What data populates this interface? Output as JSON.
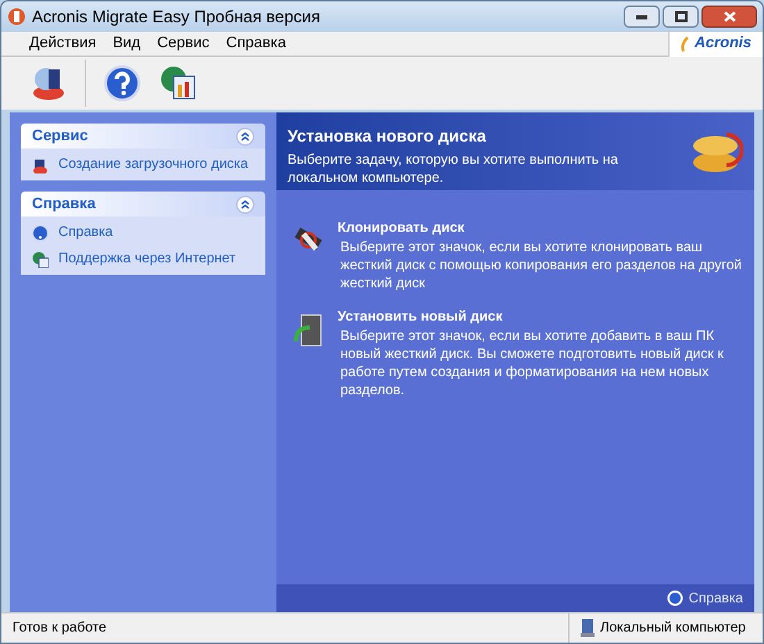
{
  "window": {
    "title": "Acronis Migrate Easy Пробная версия"
  },
  "menu": [
    "Действия",
    "Вид",
    "Сервис",
    "Справка"
  ],
  "brand": "Acronis",
  "sidebar": [
    {
      "title": "Сервис",
      "expanded": true,
      "items": [
        {
          "label": "Создание загрузочного диска",
          "kind": "disk"
        }
      ]
    },
    {
      "title": "Справка",
      "expanded": true,
      "items": [
        {
          "label": "Справка",
          "kind": "help"
        },
        {
          "label": "Поддержка через Интернет",
          "kind": "web"
        }
      ]
    }
  ],
  "header": {
    "title": "Установка нового диска",
    "subtitle": "Выберите задачу, которую вы хотите выполнить на локальном компьютере."
  },
  "tasks": [
    {
      "title": "Клонировать диск",
      "description": "Выберите этот значок, если вы хотите клонировать ваш жесткий диск с помощью копирования его разделов на другой жесткий диск",
      "kind": "clone"
    },
    {
      "title": "Установить новый диск",
      "description": "Выберите этот значок, если вы хотите добавить в ваш ПК новый жесткий диск. Вы сможете подготовить новый диск к работе путем создания и форматирования на нем новых разделов.",
      "kind": "install"
    }
  ],
  "help_link": "Справка",
  "status_bar": {
    "left": "Готов к работе",
    "right": "Локальный компьютер"
  }
}
